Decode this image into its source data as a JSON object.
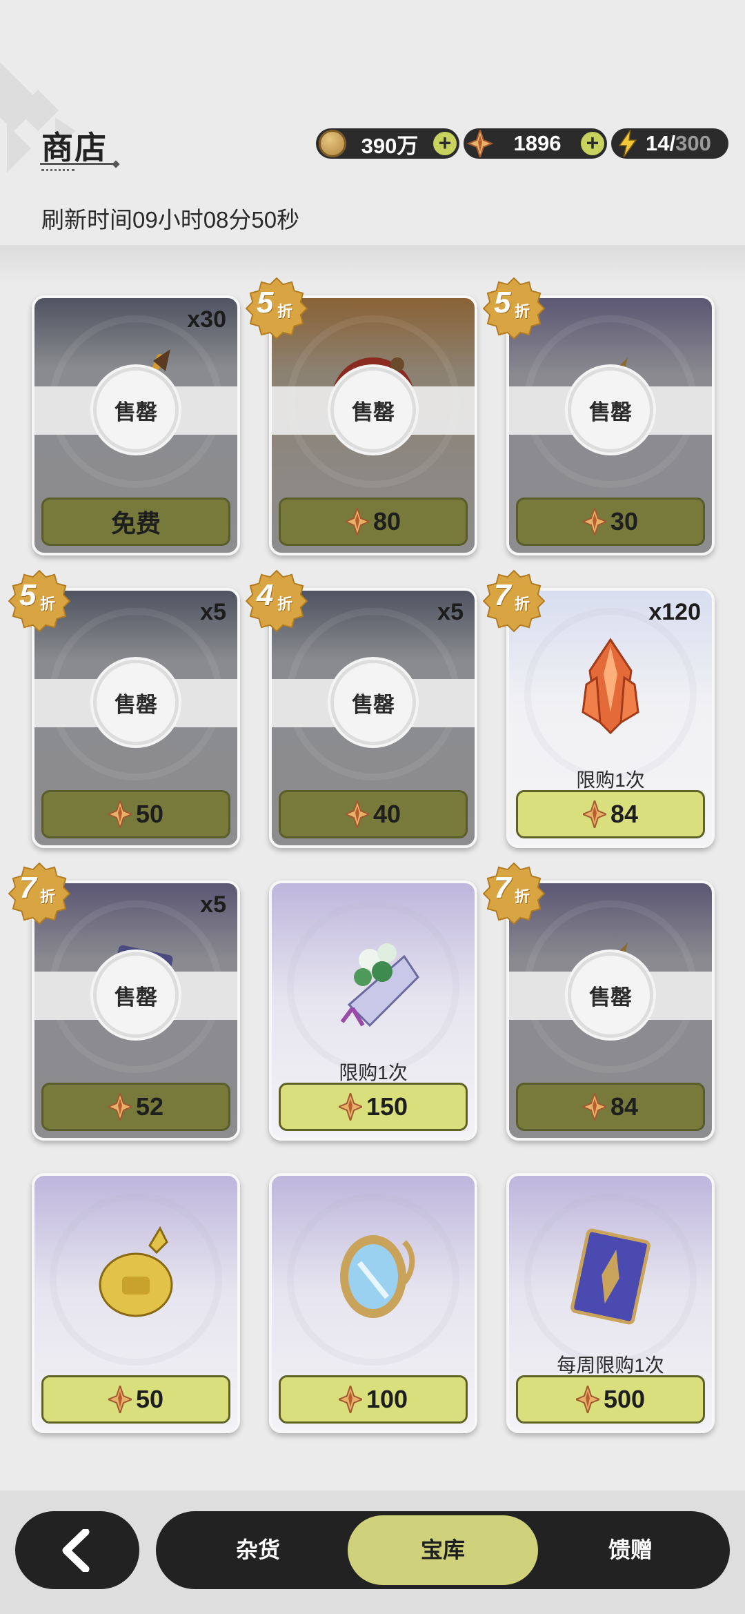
{
  "header": {
    "title": "商店",
    "refresh_text": "刷新时间09小时08分50秒",
    "resources": [
      {
        "icon": "coin-icon",
        "value": "390万",
        "has_plus": true
      },
      {
        "icon": "star-gem-icon",
        "value": "1896",
        "has_plus": true
      },
      {
        "icon": "lightning-icon",
        "value": "14/",
        "max": "300",
        "has_plus": false
      }
    ]
  },
  "sold_out_label": "售罄",
  "items": [
    {
      "count": "x30",
      "discount": null,
      "discount_suffix": "折",
      "sold_out": true,
      "price": "免费",
      "currency": null,
      "limit": null,
      "theme": "gray",
      "art": "arrow"
    },
    {
      "count": null,
      "discount": "5",
      "discount_suffix": "折",
      "sold_out": true,
      "price": "80",
      "currency": "star-gem-icon",
      "limit": null,
      "theme": "orange",
      "art": "ring"
    },
    {
      "count": null,
      "discount": "5",
      "discount_suffix": "折",
      "sold_out": true,
      "price": "30",
      "currency": "star-gem-icon",
      "limit": null,
      "theme": "purple",
      "art": "bag"
    },
    {
      "count": "x5",
      "discount": "5",
      "discount_suffix": "折",
      "sold_out": true,
      "price": "50",
      "currency": "star-gem-icon",
      "limit": null,
      "theme": "gray",
      "art": "ore"
    },
    {
      "count": "x5",
      "discount": "4",
      "discount_suffix": "折",
      "sold_out": true,
      "price": "40",
      "currency": "star-gem-icon",
      "limit": null,
      "theme": "gray",
      "art": "ore"
    },
    {
      "count": "x120",
      "discount": "7",
      "discount_suffix": "折",
      "sold_out": false,
      "price": "84",
      "currency": "star-gem-icon",
      "limit": "限购1次",
      "theme": "light",
      "art": "crystal"
    },
    {
      "count": "x5",
      "discount": "7",
      "discount_suffix": "折",
      "sold_out": true,
      "price": "52",
      "currency": "star-gem-icon",
      "limit": null,
      "theme": "purple",
      "art": "card"
    },
    {
      "count": null,
      "discount": null,
      "discount_suffix": "折",
      "sold_out": false,
      "price": "150",
      "currency": "star-gem-icon",
      "limit": "限购1次",
      "theme": "lavender",
      "art": "bouquet"
    },
    {
      "count": null,
      "discount": "7",
      "discount_suffix": "折",
      "sold_out": true,
      "price": "84",
      "currency": "star-gem-icon",
      "limit": null,
      "theme": "purple",
      "art": "bag"
    },
    {
      "count": null,
      "discount": null,
      "discount_suffix": "折",
      "sold_out": false,
      "price": "50",
      "currency": "star-gem-icon",
      "limit": null,
      "theme": "lavender",
      "art": "golden-pouch"
    },
    {
      "count": null,
      "discount": null,
      "discount_suffix": "折",
      "sold_out": false,
      "price": "100",
      "currency": "star-gem-icon",
      "limit": null,
      "theme": "lavender",
      "art": "mirror"
    },
    {
      "count": null,
      "discount": null,
      "discount_suffix": "折",
      "sold_out": false,
      "price": "500",
      "currency": "star-gem-icon",
      "limit": "每周限购1次",
      "theme": "lavender",
      "art": "blue-card"
    }
  ],
  "nav": {
    "back_icon": "chevron-left-icon",
    "tabs": [
      {
        "label": "杂货",
        "active": false
      },
      {
        "label": "宝库",
        "active": true
      },
      {
        "label": "馈赠",
        "active": false
      }
    ]
  }
}
